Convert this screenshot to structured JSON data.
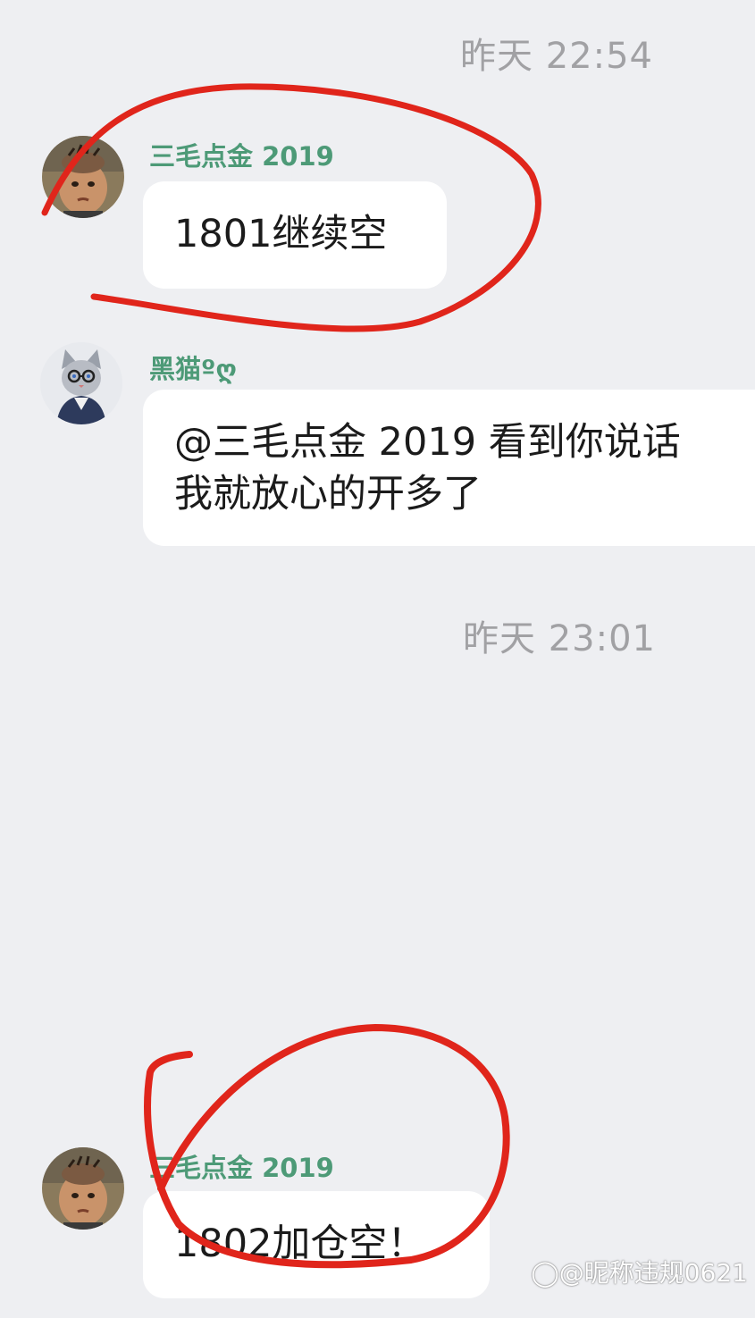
{
  "chat": {
    "timestamps": [
      "昨天  22:54",
      "昨天  23:01"
    ],
    "messages": [
      {
        "sender": "三毛点金 2019",
        "text": "1801继续空",
        "avatar_icon": "boy-avatar-icon"
      },
      {
        "sender": "黑猫ºღ",
        "text": "@三毛点金 2019 看到你说话\n我就放心的开多了",
        "avatar_icon": "cat-avatar-icon"
      },
      {
        "sender": "三毛点金 2019",
        "text": "1802加仓空！",
        "avatar_icon": "boy-avatar-icon"
      }
    ]
  },
  "watermark": {
    "text": "@昵称违规0621",
    "icon": "weibo-icon"
  },
  "colors": {
    "background": "#eeeff2",
    "sender_name": "#4d9a77",
    "bubble": "#ffffff",
    "annotation": "#e0251b"
  }
}
